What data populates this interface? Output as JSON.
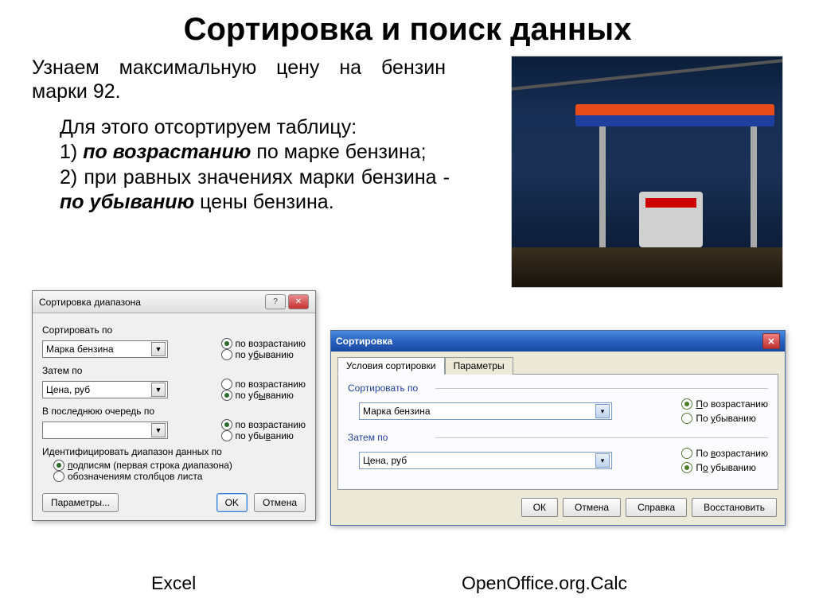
{
  "title": "Сортировка и поиск данных",
  "intro": "Узнаем максимальную цену на бензин марки 92.",
  "steps_lead": "Для этого отсортируем таблицу:",
  "step1_pre": "1) ",
  "step1_bold": "по возрастанию",
  "step1_post": " по марке бензина;",
  "step2_pre": "2) при равных значениях марки бензина - ",
  "step2_bold": "по убыванию",
  "step2_post": " цены бензина.",
  "excel": {
    "title": "Сортировка диапазона",
    "sort_by": "Сортировать по",
    "then_by": "Затем по",
    "last_by": "В последнюю очередь по",
    "combo1": "Марка бензина",
    "combo2": "Цена, руб",
    "combo3": "",
    "asc": "по возрастанию",
    "desc": "по убыванию",
    "asc_u": "по возрастанию",
    "desc_u": "по убыванию",
    "identify": "Идентифицировать диапазон данных по",
    "ident_opt1": "подписям (первая строка диапазона)",
    "ident_opt2": "обозначениям столбцов листа",
    "params": "Параметры...",
    "ok": "OK",
    "cancel": "Отмена"
  },
  "oo": {
    "title": "Сортировка",
    "tab1": "Условия сортировки",
    "tab2": "Параметры",
    "sort_by": "Сортировать по",
    "then_by": "Затем по",
    "combo1": "Марка бензина",
    "combo2": "Цена, руб",
    "asc": "По возрастанию",
    "desc": "По убыванию",
    "ok": "ОК",
    "cancel": "Отмена",
    "help": "Справка",
    "restore": "Восстановить"
  },
  "caption_excel": "Excel",
  "caption_oo": "OpenOffice.org.Calc"
}
